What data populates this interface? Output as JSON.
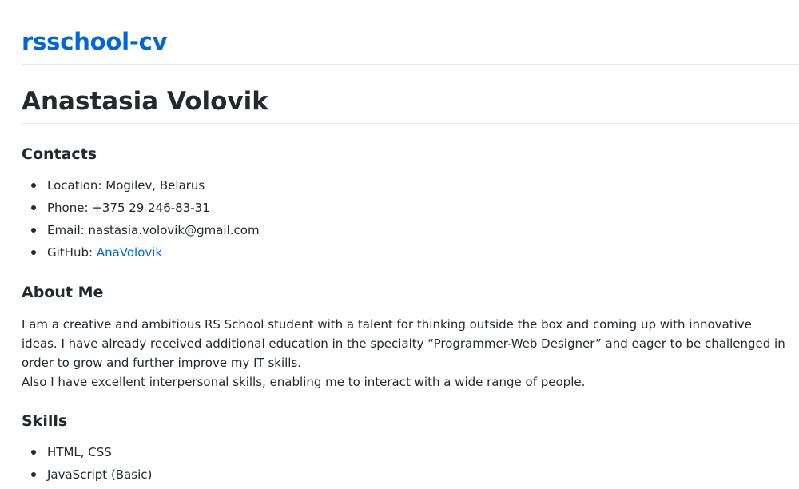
{
  "site": {
    "title": "rsschool-cv"
  },
  "cv": {
    "name": "Anastasia Volovik"
  },
  "contacts": {
    "heading": "Contacts",
    "location": "Location: Mogilev, Belarus",
    "phone": "Phone: +375 29 246-83-31",
    "email": "Email: nastasia.volovik@gmail.com",
    "github_label": "GitHub: ",
    "github_link": "AnaVolovik"
  },
  "about": {
    "heading": "About Me",
    "paragraph1": "I am a creative and ambitious RS School student with a talent for thinking outside the box and coming up with innovative ideas. I have already received additional education in the specialty “Programmer-Web Designer” and eager to be challenged in order to grow and further improve my IT skills.",
    "paragraph2": "Also I have excellent interpersonal skills, enabling me to interact with a wide range of people."
  },
  "skills": {
    "heading": "Skills",
    "items": [
      "HTML, CSS",
      "JavaScript (Basic)"
    ]
  },
  "colors": {
    "link": "#0366d6",
    "text": "#24292e",
    "divider": "#e6e8eb"
  }
}
